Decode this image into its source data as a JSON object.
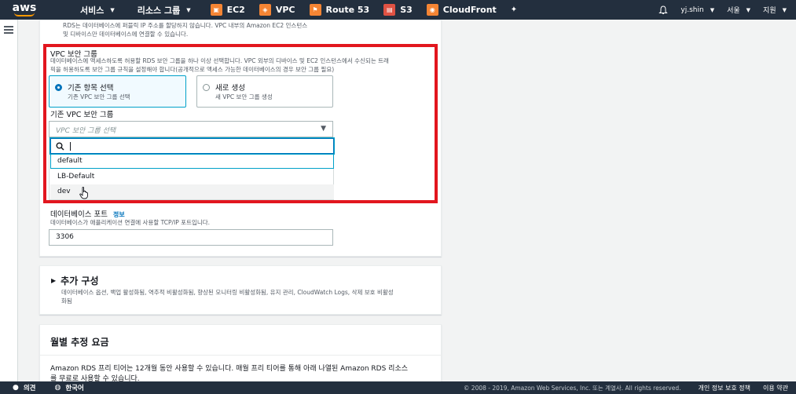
{
  "nav": {
    "logo": "aws",
    "services": "서비스",
    "resource_groups": "리소스 그룹",
    "pins": [
      {
        "label": "EC2",
        "icon": "ec2-icon",
        "color": "#f58534"
      },
      {
        "label": "VPC",
        "icon": "vpc-icon",
        "color": "#f58534"
      },
      {
        "label": "Route 53",
        "icon": "route53-icon",
        "color": "#f58534"
      },
      {
        "label": "S3",
        "icon": "s3-icon",
        "color": "#e05243"
      },
      {
        "label": "CloudFront",
        "icon": "cloudfront-icon",
        "color": "#f58534"
      }
    ],
    "user": "yj.shin",
    "region": "서울",
    "support": "지원"
  },
  "main": {
    "intro_text": "RDS는 데이터베이스에 퍼블릭 IP 주소를 할당하지 않습니다. VPC 내부의 Amazon EC2 인스턴스\n및 디바이스만 데이터베이스에 연결할 수 있습니다.",
    "sg": {
      "title": "VPC 보안 그룹",
      "desc": "데이터베이스에 액세스하도록 허용할 RDS 보안 그룹을 하나 이상 선택합니다. VPC 외부의 디바이스 및 EC2 인스턴스에서 수신되는 트래\n픽을 허용하도록 보안 그룹 규칙을 설정해야 합니다(공개적으로 액세스 가능한 데이터베이스의 경우 보안 그룹 필요)",
      "options": [
        {
          "title": "기존 항목 선택",
          "desc": "기존 VPC 보안 그룹 선택",
          "selected": true
        },
        {
          "title": "새로 생성",
          "desc": "새 VPC 보안 그룹 생성",
          "selected": false
        }
      ],
      "existing_label": "기존 VPC 보안 그룹",
      "select_placeholder": "VPC 보안 그룹 선택",
      "search_value": "",
      "dropdown_items": [
        "default",
        "LB-Default",
        "dev"
      ]
    },
    "port": {
      "label": "데이터베이스 포트",
      "info": "정보",
      "desc": "데이터베이스가 애플리케이션 연결에 사용할 TCP/IP 포트입니다.",
      "value": "3306"
    },
    "additional": {
      "title": "추가 구성",
      "desc": "데이터베이스 옵션, 백업 활성화됨, 역추적 비활성화됨, 향상된 모니터링 비활성화됨, 유지 관리, CloudWatch Logs, 삭제 보호 비활성\n화됨"
    },
    "cost": {
      "title": "월별 추정 요금",
      "desc": "Amazon RDS 프리 티어는 12개월 동안 사용할 수 있습니다. 매월 프리 티어를 통해 아래 나열된 Amazon RDS 리소스\n를 무료로 사용할 수 있습니다."
    }
  },
  "footer": {
    "feedback": "의견",
    "language": "한국어",
    "copyright": "© 2008 - 2019, Amazon Web Services, Inc. 또는 계열사. All rights reserved.",
    "privacy": "개인 정보 보호 정책",
    "terms": "이용 약관"
  },
  "colors": {
    "highlight": "#e2161e",
    "nav_bg": "#232f3e",
    "accent": "#0073bb"
  }
}
